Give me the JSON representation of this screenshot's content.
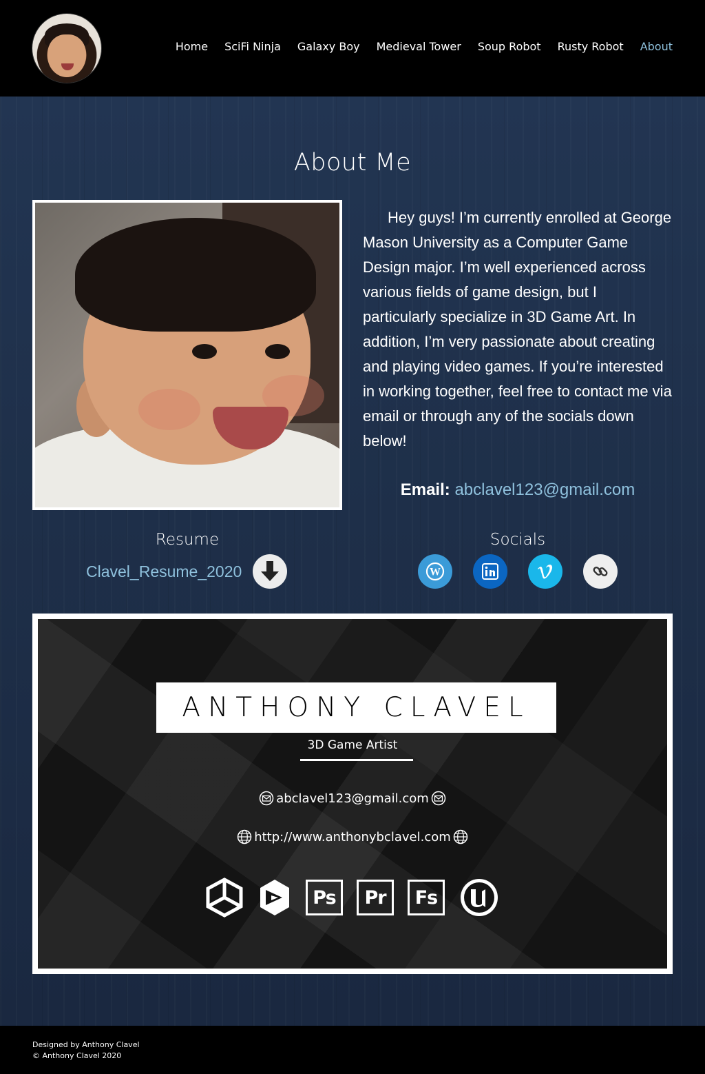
{
  "nav": {
    "items": [
      {
        "label": "Home",
        "active": false
      },
      {
        "label": "SciFi Ninja",
        "active": false
      },
      {
        "label": "Galaxy Boy",
        "active": false
      },
      {
        "label": "Medieval Tower",
        "active": false
      },
      {
        "label": "Soup Robot",
        "active": false
      },
      {
        "label": "Rusty Robot",
        "active": false
      },
      {
        "label": "About",
        "active": true
      }
    ],
    "active_color": "#8fc1dd"
  },
  "page": {
    "title": "About Me"
  },
  "bio": {
    "text": "Hey guys! I’m currently enrolled at George Mason University as a Computer Game Design major. I’m well experienced across various fields of game design, but I particularly specialize in 3D Game Art. In addition, I’m very passionate about creating and playing video games. If you’re interested in working together, feel free to contact me via email or through any of the socials down below!",
    "email_label": "Email:",
    "email": "abclavel123@gmail.com"
  },
  "resume": {
    "heading": "Resume",
    "file_label": "Clavel_Resume_2020",
    "download_icon": "download-arrow-icon"
  },
  "socials": {
    "heading": "Socials",
    "items": [
      {
        "name": "wordpress",
        "icon": "wordpress-icon",
        "color": "#3b9bd8"
      },
      {
        "name": "linkedin",
        "icon": "linkedin-icon",
        "color": "#0b66c2"
      },
      {
        "name": "vimeo",
        "icon": "vimeo-icon",
        "color": "#1ab7ea"
      },
      {
        "name": "link",
        "icon": "link-icon",
        "color": "#eeeeee"
      }
    ]
  },
  "card": {
    "name": "ANTHONY CLAVEL",
    "role": "3D Game Artist",
    "email": "abclavel123@gmail.com",
    "website": "http://www.anthonybclavel.com",
    "tools": [
      "unity-icon",
      "3dsmax-icon",
      "Ps",
      "Pr",
      "Fs",
      "unreal-icon"
    ]
  },
  "footer": {
    "line1": "Designed by Anthony Clavel",
    "line2": "© Anthony Clavel 2020"
  }
}
